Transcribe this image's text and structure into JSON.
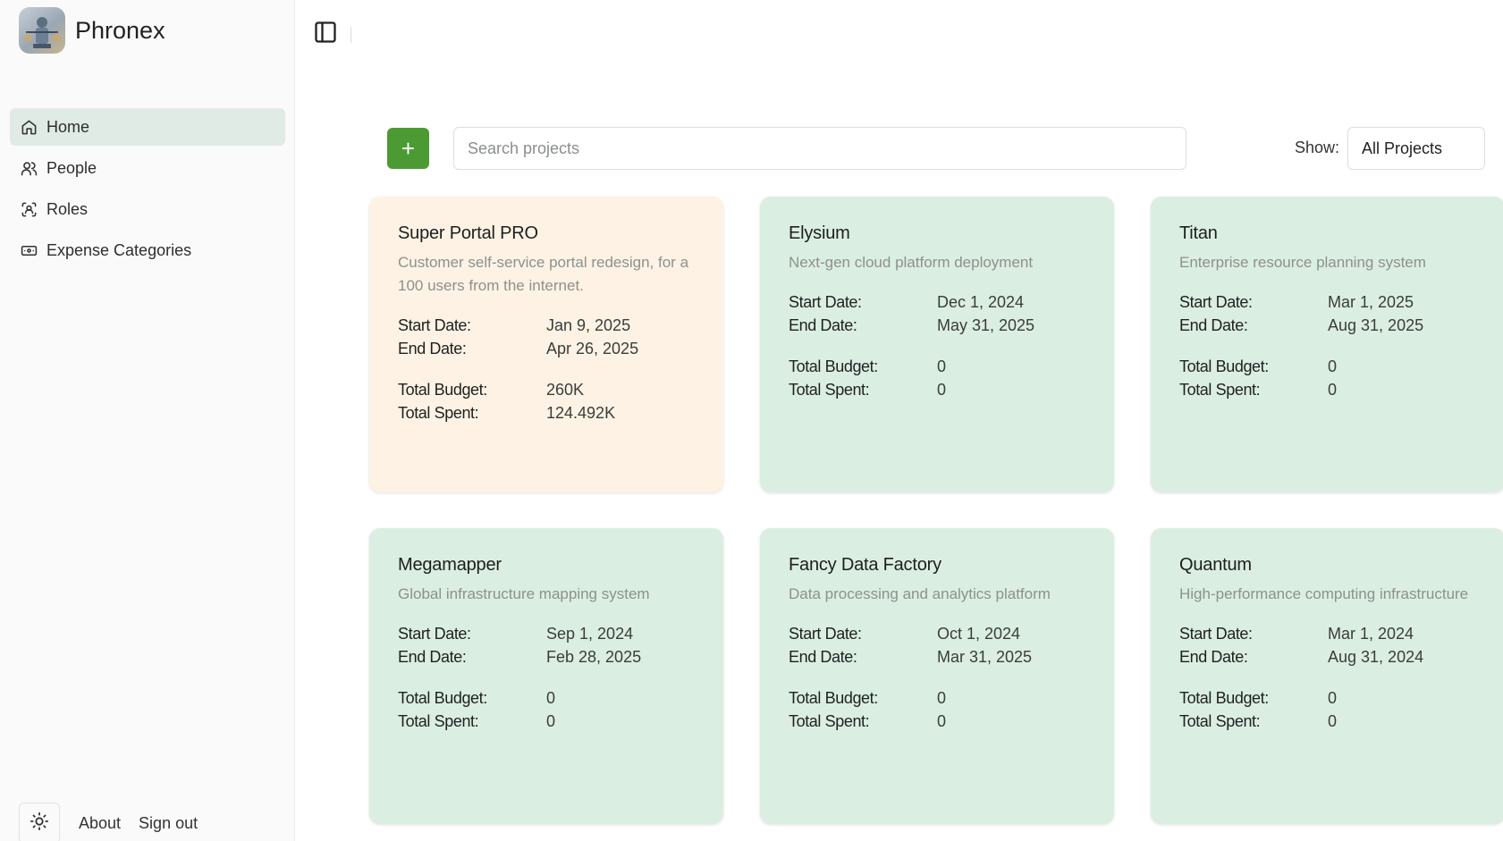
{
  "app": {
    "name": "Phronex"
  },
  "sidebar": {
    "items": [
      {
        "label": "Home",
        "icon": "home-icon",
        "active": true
      },
      {
        "label": "People",
        "icon": "people-icon",
        "active": false
      },
      {
        "label": "Roles",
        "icon": "roles-icon",
        "active": false
      },
      {
        "label": "Expense Categories",
        "icon": "wallet-icon",
        "active": false
      }
    ],
    "footer": {
      "about": "About",
      "signout": "Sign out"
    }
  },
  "toolbar": {
    "add_label": "+",
    "search_placeholder": "Search projects",
    "show_label": "Show:",
    "show_value": "All Projects"
  },
  "labels": {
    "start": "Start Date:",
    "end": "End Date:",
    "budget": "Total Budget:",
    "spent": "Total Spent:"
  },
  "projects": [
    {
      "title": "Super Portal PRO",
      "desc": "Customer self-service portal redesign, for a 100 users from the internet.",
      "start": "Jan 9, 2025",
      "end": "Apr 26, 2025",
      "budget": "260K",
      "spent": "124.492K",
      "color": "#fdf2e4"
    },
    {
      "title": "Elysium",
      "desc": "Next-gen cloud platform deployment",
      "start": "Dec 1, 2024",
      "end": "May 31, 2025",
      "budget": "0",
      "spent": "0",
      "color": "#dbeee2"
    },
    {
      "title": "Titan",
      "desc": "Enterprise resource planning system",
      "start": "Mar 1, 2025",
      "end": "Aug 31, 2025",
      "budget": "0",
      "spent": "0",
      "color": "#dbeee2"
    },
    {
      "title": "Megamapper",
      "desc": "Global infrastructure mapping system",
      "start": "Sep 1, 2024",
      "end": "Feb 28, 2025",
      "budget": "0",
      "spent": "0",
      "color": "#dbeee2"
    },
    {
      "title": "Fancy Data Factory",
      "desc": "Data processing and analytics platform",
      "start": "Oct 1, 2024",
      "end": "Mar 31, 2025",
      "budget": "0",
      "spent": "0",
      "color": "#dbeee2"
    },
    {
      "title": "Quantum",
      "desc": "High-performance computing infrastructure",
      "start": "Mar 1, 2024",
      "end": "Aug 31, 2024",
      "budget": "0",
      "spent": "0",
      "color": "#dbeee2"
    }
  ],
  "colors": {
    "accent": "#4c9a34",
    "active_nav": "#e1ebe5"
  }
}
